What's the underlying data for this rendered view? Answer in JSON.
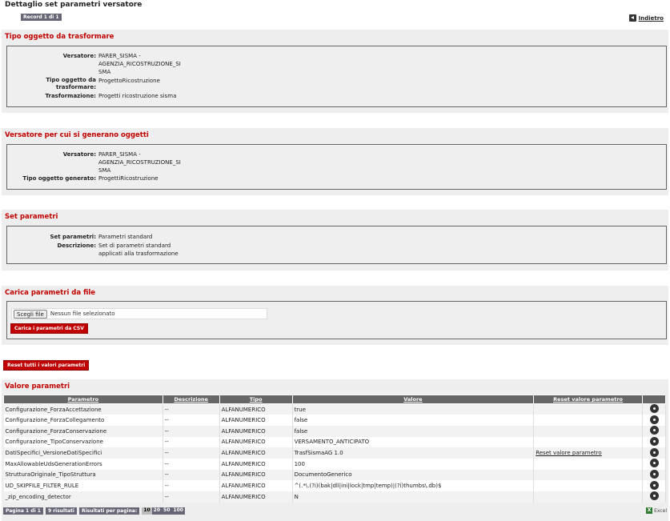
{
  "page": {
    "title": "Dettaglio set parametri versatore",
    "record": "Record 1 di 1",
    "back": "Indietro"
  },
  "sections": {
    "tipo_oggetto": {
      "title": "Tipo oggetto da trasformare",
      "fields": [
        {
          "label": "Versatore:",
          "value": "PARER_SISMA -\nAGENZIA_RICOSTRUZIONE_SI\nSMA"
        },
        {
          "label": "Tipo oggetto da\ntrasformare:",
          "value": "ProgettoRicostruzione"
        },
        {
          "label": "Trasformazione:",
          "value": "Progetti ricostruzione sisma"
        }
      ]
    },
    "versatore_gen": {
      "title": "Versatore per cui si generano oggetti",
      "fields": [
        {
          "label": "Versatore:",
          "value": "PARER_SISMA -\nAGENZIA_RICOSTRUZIONE_SI\nSMA"
        },
        {
          "label": "Tipo oggetto generato:",
          "value": "ProgettiRicostruzione"
        }
      ]
    },
    "set_parametri": {
      "title": "Set parametri",
      "fields": [
        {
          "label": "Set parametri:",
          "value": "Parametri standard"
        },
        {
          "label": "Descrizione:",
          "value": "Set di parametri standard\napplicati alla trasformazione"
        }
      ]
    },
    "carica": {
      "title": "Carica parametri da file",
      "file_button": "Scegli file",
      "file_text": "Nessun file selezionato",
      "upload_button": "Carica i parametri da CSV"
    }
  },
  "reset_all_button": "Reset tutti i valori parametri",
  "valore_parametri": {
    "title": "Valore parametri",
    "columns": [
      "Parametro",
      "Descrizione",
      "Tipo",
      "Valore",
      "Reset valore parametro",
      ""
    ],
    "rows": [
      {
        "parametro": "Configurazione_ForzaAccettazione",
        "descrizione": "--",
        "tipo": "ALFANUMERICO",
        "valore": "true",
        "reset": ""
      },
      {
        "parametro": "Configurazione_ForzaCollegamento",
        "descrizione": "--",
        "tipo": "ALFANUMERICO",
        "valore": "false",
        "reset": ""
      },
      {
        "parametro": "Configurazione_ForzaConservazione",
        "descrizione": "--",
        "tipo": "ALFANUMERICO",
        "valore": "false",
        "reset": ""
      },
      {
        "parametro": "Configurazione_TipoConservazione",
        "descrizione": "--",
        "tipo": "ALFANUMERICO",
        "valore": "VERSAMENTO_ANTICIPATO",
        "reset": ""
      },
      {
        "parametro": "DatiSpecifici_VersioneDatiSpecifici",
        "descrizione": "--",
        "tipo": "ALFANUMERICO",
        "valore": "TrasfSismaAG 1.0",
        "reset": "Reset valore parametro"
      },
      {
        "parametro": "MaxAllowableUdsGenerationErrors",
        "descrizione": "--",
        "tipo": "ALFANUMERICO",
        "valore": "100",
        "reset": ""
      },
      {
        "parametro": "StrutturaOriginale_TipoStruttura",
        "descrizione": "--",
        "tipo": "ALFANUMERICO",
        "valore": "DocumentoGenerico",
        "reset": ""
      },
      {
        "parametro": "UD_SKIPFILE_FILTER_RULE",
        "descrizione": "--",
        "tipo": "ALFANUMERICO",
        "valore": "^(.*\\.(?i)(bak|dll|ini|lock|tmp|temp)|(?i)thumbs\\.db)$",
        "reset": ""
      },
      {
        "parametro": "_zip_encoding_detector",
        "descrizione": "--",
        "tipo": "ALFANUMERICO",
        "valore": "N",
        "reset": ""
      }
    ]
  },
  "pager": {
    "page": "Pagina 1 di 1",
    "results": "9 risultati",
    "per_page_label": "Risultati per pagina:",
    "sizes": [
      "10",
      "20",
      "50",
      "100"
    ],
    "excel": "Excel"
  }
}
